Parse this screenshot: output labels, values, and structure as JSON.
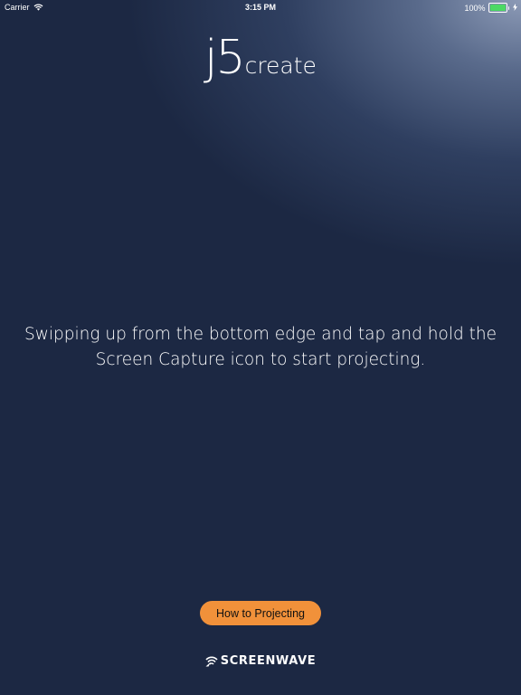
{
  "status_bar": {
    "carrier": "Carrier",
    "time": "3:15 PM",
    "battery_percent": "100%",
    "battery_level": 1.0,
    "battery_color": "#4cd964"
  },
  "logo": {
    "mark": "j5",
    "word": "create"
  },
  "instructions": {
    "line1": "Swipping up from the bottom edge and tap and hold the",
    "line2": "Screen Capture icon to start projecting."
  },
  "actions": {
    "how_to_label": "How to Projecting",
    "accent_color": "#f1913a"
  },
  "brand": {
    "name": "SCREENWAVE"
  },
  "icons": [
    "wifi-icon",
    "battery-icon",
    "charging-bolt-icon",
    "screenwave-logo-icon"
  ]
}
